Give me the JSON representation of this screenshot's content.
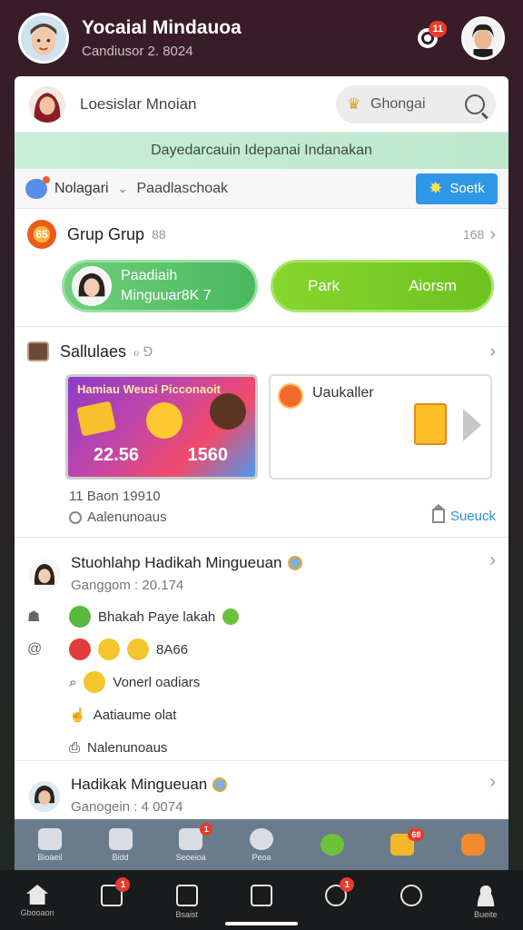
{
  "top": {
    "title": "Yocaial Mindauoa",
    "subtitle": "Candiusor 2. 8024",
    "notification_count": "11"
  },
  "card_header": {
    "title": "Loesislar Mnoian",
    "search_label": "Ghongai"
  },
  "banner": {
    "text": "Dayedarcauin Idepanai Indanakan"
  },
  "filter": {
    "left_label": "Nolagari",
    "right_label": "Paadlaschoak",
    "button_label": "Soetk"
  },
  "group": {
    "title": "Grup Grup",
    "title_extra": "88",
    "right_text": "168",
    "icon_text": "65",
    "button1_line1": "Paadiaih",
    "button1_line2": "Minguuar8K 7",
    "button2_left": "Park",
    "button2_right": "Aiorsm"
  },
  "schedule": {
    "title": "Sallulaes",
    "title_extra": "ℴ ⅁",
    "tile1_title": "Hamiau Weusi Picconaoit",
    "tile1_num1": "22.56",
    "tile1_num2": "1560",
    "tile2_title": "Uaukaller",
    "footer_line1": "11 Baon 19910",
    "footer_line2": "Aalenunoaus",
    "soek_link": "Sueuck"
  },
  "post1": {
    "title": "Stuohlahp Hadikah Mingueuan",
    "subtitle": "Ganggom : 20.174",
    "row1": "Bhakah Paye lakah",
    "row2": "8A66",
    "row3": "Vonerl oadiars",
    "row4": "Aatiaume olat",
    "row5": "Nalenunoaus"
  },
  "post2": {
    "title": "Hadikak Mingueuan",
    "subtitle": "Ganogein : 4 0074"
  },
  "card_nav": [
    {
      "label": "Bioaeil",
      "icon": "home-icon",
      "badge": ""
    },
    {
      "label": "Bidd",
      "icon": "list-icon",
      "badge": ""
    },
    {
      "label": "Seoeioa",
      "icon": "chat-icon",
      "badge": "1"
    },
    {
      "label": "Peoa",
      "icon": "circle-icon",
      "badge": ""
    },
    {
      "label": "",
      "icon": "green-ring-icon",
      "badge": ""
    },
    {
      "label": "",
      "icon": "gift-icon",
      "badge": "68"
    },
    {
      "label": "",
      "icon": "mascot-icon",
      "badge": ""
    }
  ],
  "sys_nav": [
    {
      "label": "Gbooaon",
      "icon": "home-icon",
      "badge": ""
    },
    {
      "label": "",
      "icon": "list-icon",
      "badge": "1"
    },
    {
      "label": "Bsaist",
      "icon": "check-box-icon",
      "badge": ""
    },
    {
      "label": "",
      "icon": "clipboard-icon",
      "badge": ""
    },
    {
      "label": "",
      "icon": "chat-icon",
      "badge": "1"
    },
    {
      "label": "",
      "icon": "search-icon",
      "badge": ""
    },
    {
      "label": "Bueite",
      "icon": "profile-icon",
      "badge": ""
    }
  ],
  "colors": {
    "accent_blue": "#2f97e6",
    "green": "#6ec21f",
    "badge_red": "#e83b2c",
    "banner_green": "#c9eed8"
  }
}
